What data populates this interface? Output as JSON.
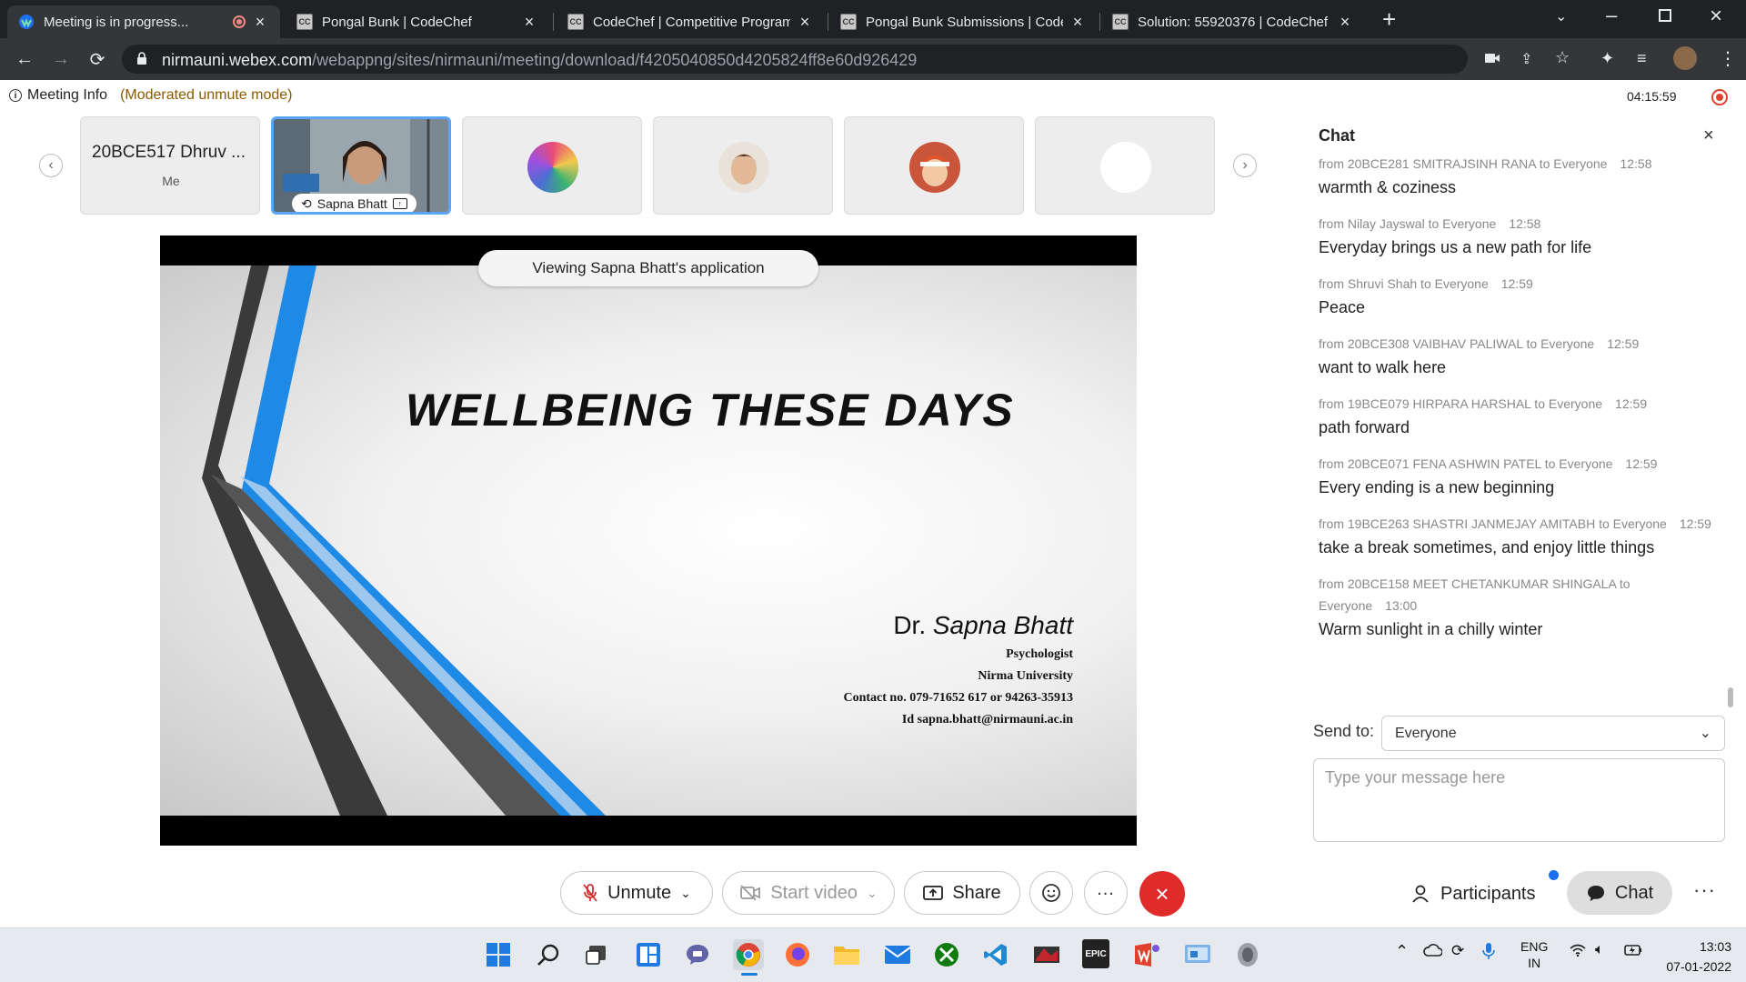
{
  "browser": {
    "tabs": [
      {
        "title": "Meeting is in progress...",
        "active": true
      },
      {
        "title": "Pongal Bunk | CodeChef"
      },
      {
        "title": "CodeChef | Competitive Program"
      },
      {
        "title": "Pongal Bunk Submissions | Codec"
      },
      {
        "title": "Solution: 55920376 | CodeChef"
      }
    ],
    "favicon_text": "CC",
    "url_host": "nirmauni.webex.com",
    "url_path": "/webappng/sites/nirmauni/meeting/download/f4205040850d4205824ff8e60d926429"
  },
  "meeting": {
    "info_label": "Meeting Info",
    "mode": "(Moderated unmute mode)",
    "timer": "04:15:59"
  },
  "participants": {
    "self_name": "20BCE517 Dhruv ...",
    "self_tag": "Me",
    "presenter_name": "Sapna Bhatt"
  },
  "content": {
    "viewing_label": "Viewing Sapna Bhatt's application",
    "slide_title": "WELLBEING  THESE DAYS",
    "presenter_dr": "Dr.",
    "presenter_full": "Sapna Bhatt",
    "role": "Psychologist",
    "org": "Nirma University",
    "contact": "Contact no.  079-71652 617 or 94263-35913",
    "email": "Id sapna.bhatt@nirmauni.ac.in"
  },
  "controls": {
    "unmute": "Unmute",
    "start_video": "Start video",
    "share": "Share",
    "more": "...",
    "participants": "Participants",
    "chat": "Chat"
  },
  "chat": {
    "title": "Chat",
    "messages": [
      {
        "from": "from 20BCE281 SMITRAJSINH RANA to Everyone",
        "time": "12:58",
        "text": "warmth & coziness"
      },
      {
        "from": "from Nilay Jayswal to Everyone",
        "time": "12:58",
        "text": "Everyday brings us a new path for life"
      },
      {
        "from": "from Shruvi Shah to Everyone",
        "time": "12:59",
        "text": "Peace"
      },
      {
        "from": "from 20BCE308 VAIBHAV PALIWAL to Everyone",
        "time": "12:59",
        "text": "want to walk here"
      },
      {
        "from": "from 19BCE079 HIRPARA HARSHAL to Everyone",
        "time": "12:59",
        "text": "path forward"
      },
      {
        "from": "from 20BCE071 FENA ASHWIN PATEL to Everyone",
        "time": "12:59",
        "text": "Every ending is a new beginning"
      },
      {
        "from": "from 19BCE263 SHASTRI JANMEJAY AMITABH to Everyone",
        "time": "12:59",
        "text": "take a break sometimes, and enjoy little things"
      },
      {
        "from": "from 20BCE158 MEET CHETANKUMAR SHINGALA to Everyone",
        "time": "13:00",
        "text": "Warm sunlight in a chilly winter"
      }
    ],
    "send_to_label": "Send to:",
    "send_to_value": "Everyone",
    "input_placeholder": "Type your message here"
  },
  "taskbar": {
    "lang": "ENG",
    "region": "IN",
    "time": "13:03",
    "date": "07-01-2022",
    "epic_label": "EPIC"
  },
  "colors": {
    "webex_blue": "#1d6ff2",
    "end_red": "#e02b2b",
    "slide_blue": "#1e8ae6",
    "slide_dark": "#3a3a3a"
  }
}
